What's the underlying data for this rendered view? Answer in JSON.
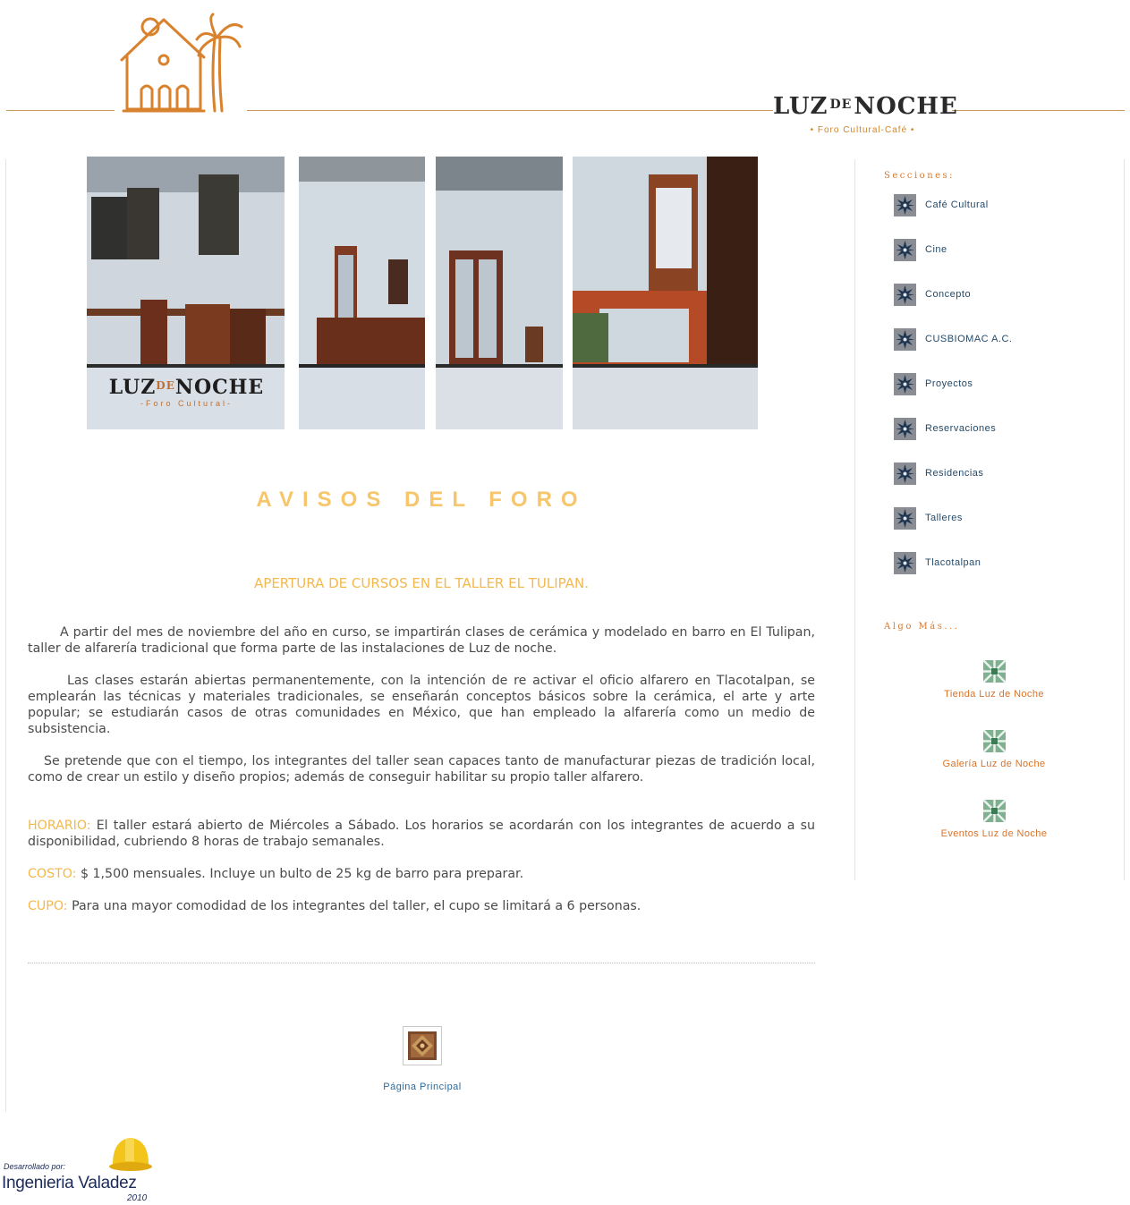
{
  "header": {
    "brand_title_a": "LUZ",
    "brand_title_de": "DE",
    "brand_title_b": "NOCHE",
    "brand_subtitle": "• Foro Cultural-Café •"
  },
  "photo_caption": {
    "title_a": "LUZ",
    "title_de": "DE",
    "title_b": "NOCHE",
    "subtitle": "-Foro Cultural-"
  },
  "main": {
    "section_title": "AVISOS DEL FORO",
    "post_title": "APERTURA DE CURSOS EN EL TALLER EL TULIPAN.",
    "paragraphs": [
      "A partir del mes de noviembre del año en curso, se impartirán clases de cerámica y modelado en barro en El Tulipan, taller de alfarería tradicional que forma parte de las instalaciones de Luz de noche.",
      "Las clases estarán abiertas permanentemente, con la intención de re activar el oficio alfarero en Tlacotalpan, se emplearán las técnicas y materiales tradicionales, se enseñarán conceptos básicos sobre la cerámica, el arte y arte popular; se estudiarán casos de otras comunidades en México, que han empleado la alfarería como un medio de subsistencia.",
      "Se pretende que con el tiempo, los integrantes del taller sean capaces tanto de manufacturar piezas de tradición local, como de crear un estilo y diseño propios; además de conseguir habilitar su propio taller alfarero."
    ],
    "horario": {
      "label": "HORARIO:",
      "text": "El taller estará abierto de Miércoles a Sábado. Los horarios se acordarán con los integrantes de acuerdo a su disponibilidad, cubriendo 8 horas de trabajo semanales."
    },
    "costo": {
      "label": "COSTO:",
      "text": "$ 1,500 mensuales. Incluye un bulto de 25 kg de barro para preparar."
    },
    "cupo": {
      "label": "CUPO:",
      "text": "Para una mayor comodidad de los integrantes del taller, el cupo se limitará a 6 personas."
    },
    "home_link": "Página Principal"
  },
  "sidebar": {
    "sections_heading": "Secciones:",
    "sections": [
      {
        "label": "Café Cultural"
      },
      {
        "label": "Cine"
      },
      {
        "label": "Concepto"
      },
      {
        "label": "CUSBIOMAC A.C."
      },
      {
        "label": "Proyectos"
      },
      {
        "label": "Reservaciones"
      },
      {
        "label": "Residencias"
      },
      {
        "label": "Talleres"
      },
      {
        "label": "Tlacotalpan"
      }
    ],
    "more_heading": "Algo Más...",
    "more": [
      {
        "label": "Tienda Luz de Noche"
      },
      {
        "label": "Galería Luz de Noche"
      },
      {
        "label": "Eventos Luz de Noche"
      }
    ]
  },
  "credit": {
    "by": "Desarrollado por:",
    "name": "Ingenieria Valadez",
    "year": "2010"
  },
  "colors": {
    "accent_orange": "#d9782d",
    "title_yellow": "#f7c56a",
    "label_yellow": "#f5b748",
    "link_blue": "#244a69",
    "body_text": "#4a4a4a"
  },
  "icons": {
    "section_bullet": "star-tile-icon",
    "more_bullet": "green-tile-icon",
    "home": "home-tile-icon",
    "logo": "house-palm-logo",
    "credit": "hard-hat-icon"
  }
}
